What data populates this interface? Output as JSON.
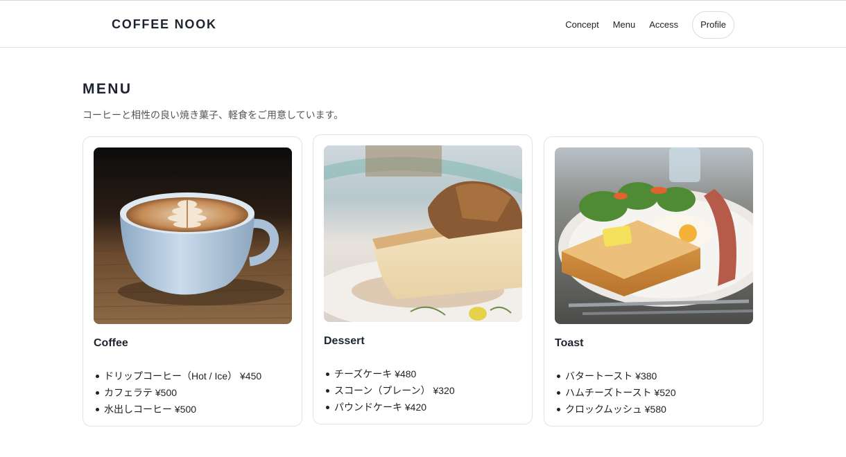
{
  "header": {
    "logo": "COFFEE NOOK",
    "nav": [
      "Concept",
      "Menu",
      "Access"
    ],
    "profile_label": "Profile"
  },
  "section": {
    "title": "MENU",
    "lead": "コーヒーと相性の良い焼き菓子、軽食をご用意しています。"
  },
  "cards": [
    {
      "title": "Coffee",
      "image": "latte-art-cup-photo",
      "items": [
        "ドリップコーヒー（Hot / Ice） ¥450",
        "カフェラテ ¥500",
        "水出しコーヒー ¥500"
      ]
    },
    {
      "title": "Dessert",
      "image": "cheesecake-slice-photo",
      "items": [
        "チーズケーキ ¥480",
        "スコーン（プレーン） ¥320",
        "パウンドケーキ ¥420"
      ]
    },
    {
      "title": "Toast",
      "image": "toast-breakfast-plate-photo",
      "items": [
        "バタートースト ¥380",
        "ハムチーズトースト ¥520",
        "クロックムッシュ ¥580"
      ]
    }
  ],
  "colors": {
    "heading": "#1d2430",
    "border": "#e2e2e2",
    "lead_text": "#555555"
  }
}
